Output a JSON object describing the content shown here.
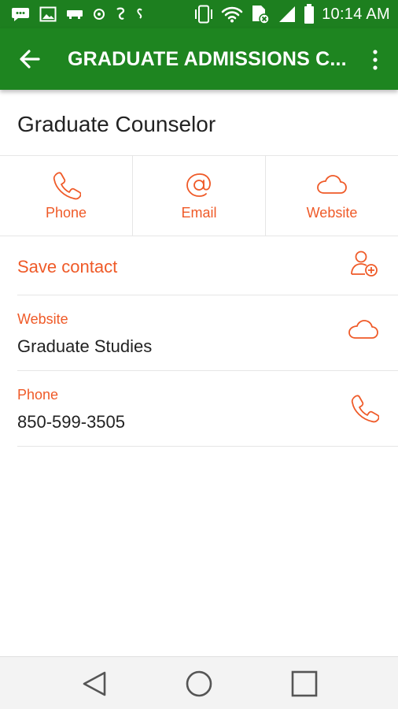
{
  "status_bar": {
    "time": "10:14 AM"
  },
  "app_bar": {
    "title": "GRADUATE ADMISSIONS C..."
  },
  "contact": {
    "name": "Graduate Counselor"
  },
  "actions": [
    {
      "label": "Phone",
      "icon": "phone-icon"
    },
    {
      "label": "Email",
      "icon": "at-icon"
    },
    {
      "label": "Website",
      "icon": "cloud-icon"
    }
  ],
  "save_contact": {
    "label": "Save contact",
    "icon": "add-contact-icon"
  },
  "details": {
    "website": {
      "label": "Website",
      "value": "Graduate Studies",
      "icon": "cloud-icon"
    },
    "phone": {
      "label": "Phone",
      "value": "850-599-3505",
      "icon": "phone-icon"
    }
  },
  "colors": {
    "status_bar": "#1d7f1f",
    "app_bar": "#1e8520",
    "accent": "#ef5a28",
    "text": "#222222",
    "nav_bar": "#f3f3f3"
  }
}
